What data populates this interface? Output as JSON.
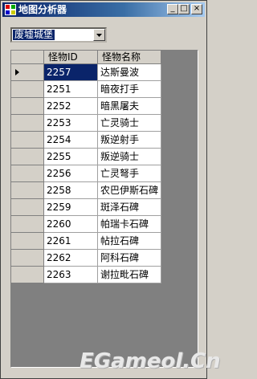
{
  "window": {
    "title": "地图分析器"
  },
  "titlebar_buttons": {
    "minimize": "_",
    "maximize": "□",
    "close": "×"
  },
  "map_select": {
    "value": "废墟城堡"
  },
  "grid": {
    "columns": [
      "怪物ID",
      "怪物名称"
    ],
    "rows": [
      [
        "2257",
        "达斯曼波"
      ],
      [
        "2251",
        "暗夜打手"
      ],
      [
        "2252",
        "暗黑屠夫"
      ],
      [
        "2253",
        "亡灵骑士"
      ],
      [
        "2254",
        "叛逆射手"
      ],
      [
        "2255",
        "叛逆骑士"
      ],
      [
        "2256",
        "亡灵弩手"
      ],
      [
        "2258",
        "农巴伊斯石碑"
      ],
      [
        "2259",
        "斑泽石碑"
      ],
      [
        "2260",
        "帕瑞卡石碑"
      ],
      [
        "2261",
        "帖拉石碑"
      ],
      [
        "2262",
        "阿科石碑"
      ],
      [
        "2263",
        "谢拉毗石碑"
      ]
    ],
    "selected_row": 0
  },
  "watermark": "EGameol.Cn"
}
